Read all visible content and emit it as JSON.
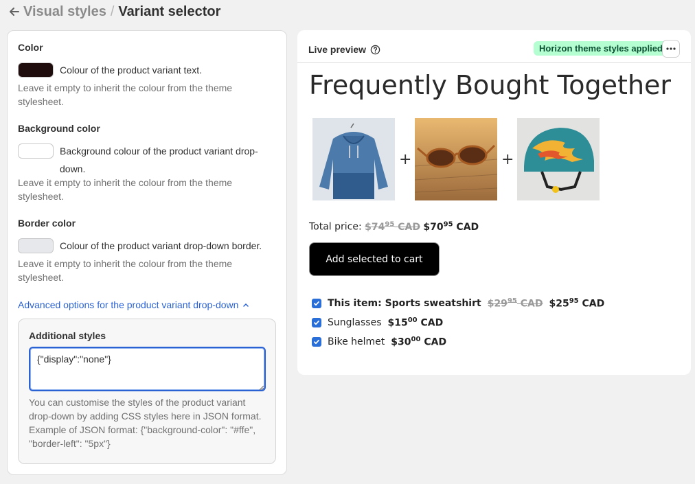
{
  "breadcrumb": {
    "parent": "Visual styles",
    "separator": "/",
    "current": "Variant selector"
  },
  "color_section": {
    "title": "Color",
    "swatch_color": "#1f0c0c",
    "description": "Colour of the product variant text.",
    "help": "Leave it empty to inherit the colour from the theme stylesheet."
  },
  "background_section": {
    "title": "Background color",
    "swatch_color": "#ffffff",
    "description": "Background colour of the product variant drop-down.",
    "help": "Leave it empty to inherit the colour from the theme stylesheet."
  },
  "border_section": {
    "title": "Border color",
    "swatch_color": "#e6e8ec",
    "description": "Colour of the product variant drop-down border.",
    "help": "Leave it empty to inherit the colour from the theme stylesheet."
  },
  "advanced": {
    "link": "Advanced options for the product variant drop-down",
    "title": "Additional styles",
    "value": "{\"display\":\"none\"}",
    "help": "You can customise the styles of the product variant drop-down by adding CSS styles here in JSON format. Example of JSON format: {\"background-color\": \"#ffe\", \"border-left\": \"5px\"}"
  },
  "preview": {
    "title": "Live preview",
    "badge": "Horizon theme styles applied",
    "heading": "Frequently Bought Together",
    "plus": "+",
    "products": [
      {
        "name": "hoodie-image"
      },
      {
        "name": "sunglasses-image"
      },
      {
        "name": "helmet-image"
      }
    ],
    "total": {
      "label": "Total price:",
      "old_main": "$74",
      "old_cents": "95",
      "old_cur": "CAD",
      "new_main": "$70",
      "new_cents": "95",
      "new_cur": "CAD"
    },
    "cart_button": "Add selected to cart",
    "items": [
      {
        "label": "This item: Sports sweatshirt",
        "old_main": "$29",
        "old_cents": "95",
        "old_cur": "CAD",
        "main": "$25",
        "cents": "95",
        "cur": "CAD"
      },
      {
        "label": "Sunglasses",
        "main": "$15",
        "cents": "00",
        "cur": "CAD"
      },
      {
        "label": "Bike helmet",
        "main": "$30",
        "cents": "00",
        "cur": "CAD"
      }
    ]
  },
  "colors": {
    "accent": "#2a62d4",
    "badge_bg": "#b4fed2",
    "checkbox": "#2a6fd8"
  }
}
